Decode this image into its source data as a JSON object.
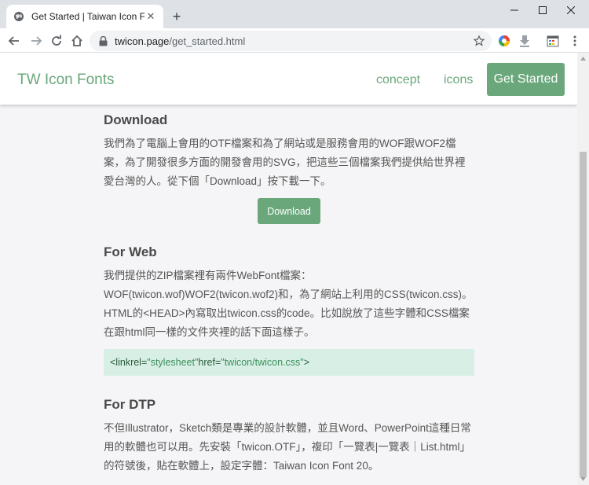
{
  "browser": {
    "tab_title": "Get Started | Taiwan Icon Font",
    "url_host": "twicon.page",
    "url_path": "/get_started.html"
  },
  "site": {
    "brand": "TW Icon Fonts",
    "nav": {
      "concept": "concept",
      "icons": "icons",
      "get_started": "Get Started"
    }
  },
  "sections": {
    "download": {
      "heading": "Download",
      "body": "我們為了電腦上會用的OTF檔案和為了網站或是服務會用的WOF跟WOF2檔案，為了開發很多方面的開發會用的SVG，把這些三個檔案我們提供給世界裡愛台灣的人。從下個「Download」按下載一下。",
      "button": "Download"
    },
    "web": {
      "heading": "For Web",
      "body": "我們提供的ZIP檔案裡有兩件WebFont檔案：WOF(twicon.wof)WOF2(twicon.wof2)和，為了網站上利用的CSS(twicon.css)。HTML的<HEAD>內寫取出twicon.css的code。比如說放了這些字體和CSS檔案在跟html同一樣的文件夾裡的話下面這樣子。",
      "code_tag_open": "<link ",
      "code_rel_attr": "rel=",
      "code_rel_val": "\"stylesheet\"",
      "code_href_attr": " href=",
      "code_href_val": "\"twicon/twicon.css\"",
      "code_tag_close": ">"
    },
    "dtp": {
      "heading": "For DTP",
      "body": "不但Illustrator，Sketch類是專業的設計軟體，並且Word、PowerPoint這種日常用的軟體也可以用。先安裝「twicon.OTF」，複印「一覽表|一覽表｜List.html」的符號後，貼在軟體上，設定字體：Taiwan Icon Font 20。"
    }
  },
  "colors": {
    "accent": "#6aa77b",
    "code_bg": "#d8efe5",
    "page_bg": "#f5f5f7"
  }
}
